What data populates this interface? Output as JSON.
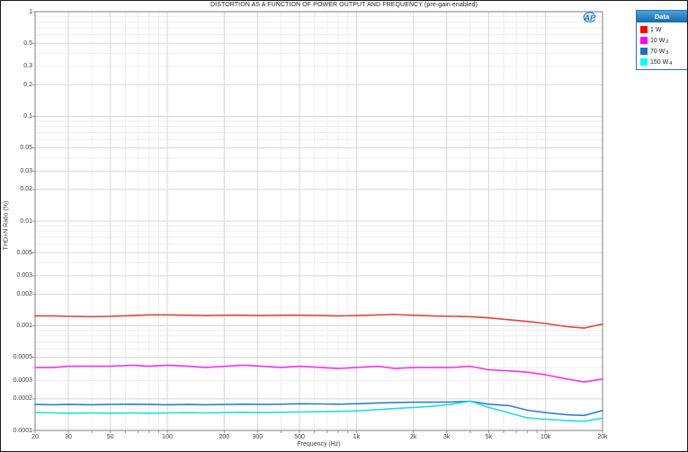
{
  "window": {
    "title": "DISTORTION AS A FUNCTION OF POWER OUTPUT AND FREQUENCY (pre-gain enabled)"
  },
  "logo": {
    "text": "AP",
    "color": "#1b75c0"
  },
  "legend": {
    "header": "Data",
    "header_bg": "#1d74b8",
    "items": [
      {
        "label": "1 W",
        "sub": "",
        "color": "#ff0000"
      },
      {
        "label": "10 W",
        "sub": "2",
        "color": "#ff00ff"
      },
      {
        "label": "70 W",
        "sub": "3",
        "color": "#1673be"
      },
      {
        "label": "150 W",
        "sub": "4",
        "color": "#00ffff"
      }
    ]
  },
  "chart_data": {
    "type": "line",
    "title": "DISTORTION AS A FUNCTION OF POWER OUTPUT AND FREQUENCY (pre-gain enabled)",
    "xlabel": "Frequency (Hz)",
    "ylabel": "THD+N Ratio (%)",
    "x_scale": "log",
    "y_scale": "log",
    "xlim": [
      20,
      20000
    ],
    "ylim": [
      0.0001,
      1
    ],
    "grid": "on",
    "legend_position": "top-right-outside",
    "x_ticks": [
      {
        "v": 20,
        "label": "20"
      },
      {
        "v": 30,
        "label": "30"
      },
      {
        "v": 50,
        "label": "50"
      },
      {
        "v": 100,
        "label": "100"
      },
      {
        "v": 200,
        "label": "200"
      },
      {
        "v": 300,
        "label": "300"
      },
      {
        "v": 500,
        "label": "500"
      },
      {
        "v": 1000,
        "label": "1k"
      },
      {
        "v": 2000,
        "label": "2k"
      },
      {
        "v": 3000,
        "label": "3k"
      },
      {
        "v": 5000,
        "label": "5k"
      },
      {
        "v": 10000,
        "label": "10k"
      },
      {
        "v": 20000,
        "label": "20k"
      }
    ],
    "y_ticks": [
      {
        "v": 1,
        "label": "1"
      },
      {
        "v": 0.5,
        "label": "0.5"
      },
      {
        "v": 0.3,
        "label": "0.3"
      },
      {
        "v": 0.2,
        "label": "0.2"
      },
      {
        "v": 0.1,
        "label": "0.1"
      },
      {
        "v": 0.05,
        "label": "0.05"
      },
      {
        "v": 0.03,
        "label": "0.03"
      },
      {
        "v": 0.02,
        "label": "0.02"
      },
      {
        "v": 0.01,
        "label": "0.01"
      },
      {
        "v": 0.005,
        "label": "0.005"
      },
      {
        "v": 0.003,
        "label": "0.003"
      },
      {
        "v": 0.002,
        "label": "0.002"
      },
      {
        "v": 0.001,
        "label": "0.001"
      },
      {
        "v": 0.0005,
        "label": "0.0005"
      },
      {
        "v": 0.0003,
        "label": "0.0003"
      },
      {
        "v": 0.0002,
        "label": "0.0002"
      },
      {
        "v": 0.0001,
        "label": "0.0001"
      }
    ],
    "x": [
      20,
      25,
      30,
      40,
      50,
      65,
      80,
      100,
      130,
      160,
      200,
      250,
      320,
      400,
      500,
      650,
      800,
      1000,
      1300,
      1600,
      2000,
      2500,
      3200,
      4000,
      5000,
      6500,
      8000,
      10000,
      13000,
      16000,
      20000
    ],
    "series": [
      {
        "name": "1 W",
        "color": "#e8413c",
        "values": [
          0.00124,
          0.00124,
          0.00123,
          0.00122,
          0.00123,
          0.00125,
          0.00127,
          0.00127,
          0.00126,
          0.00125,
          0.00126,
          0.00126,
          0.00125,
          0.00126,
          0.00126,
          0.00125,
          0.00124,
          0.00125,
          0.00127,
          0.00128,
          0.00126,
          0.00124,
          0.00123,
          0.00122,
          0.00119,
          0.00114,
          0.0011,
          0.00105,
          0.00098,
          0.00095,
          0.00104
        ]
      },
      {
        "name": "10 W",
        "color": "#fb30f1",
        "values": [
          0.0004,
          0.0004,
          0.00041,
          0.00041,
          0.00041,
          0.00042,
          0.00041,
          0.00042,
          0.00041,
          0.0004,
          0.00041,
          0.00042,
          0.00041,
          0.0004,
          0.00041,
          0.0004,
          0.00039,
          0.0004,
          0.00041,
          0.00039,
          0.0004,
          0.0004,
          0.0004,
          0.00041,
          0.00038,
          0.00037,
          0.00036,
          0.00034,
          0.00031,
          0.00029,
          0.00031
        ]
      },
      {
        "name": "70 W",
        "color": "#2e82c6",
        "values": [
          0.000177,
          0.000176,
          0.000177,
          0.000176,
          0.000177,
          0.000178,
          0.000177,
          0.000176,
          0.000177,
          0.000176,
          0.000177,
          0.000178,
          0.000177,
          0.000178,
          0.00018,
          0.000179,
          0.000178,
          0.00018,
          0.000183,
          0.000185,
          0.000186,
          0.000186,
          0.000187,
          0.00019,
          0.000178,
          0.000172,
          0.000156,
          0.000148,
          0.000141,
          0.000139,
          0.000155
        ]
      },
      {
        "name": "150 W",
        "color": "#1edcec",
        "values": [
          0.000148,
          0.000147,
          0.000146,
          0.000147,
          0.000146,
          0.000147,
          0.000146,
          0.000147,
          0.000148,
          0.000147,
          0.000148,
          0.000149,
          0.000148,
          0.000149,
          0.00015,
          0.000151,
          0.000152,
          0.000154,
          0.000158,
          0.000162,
          0.000166,
          0.00017,
          0.000178,
          0.00019,
          0.000166,
          0.000146,
          0.000132,
          0.000128,
          0.000124,
          0.000122,
          0.000131
        ]
      }
    ]
  }
}
